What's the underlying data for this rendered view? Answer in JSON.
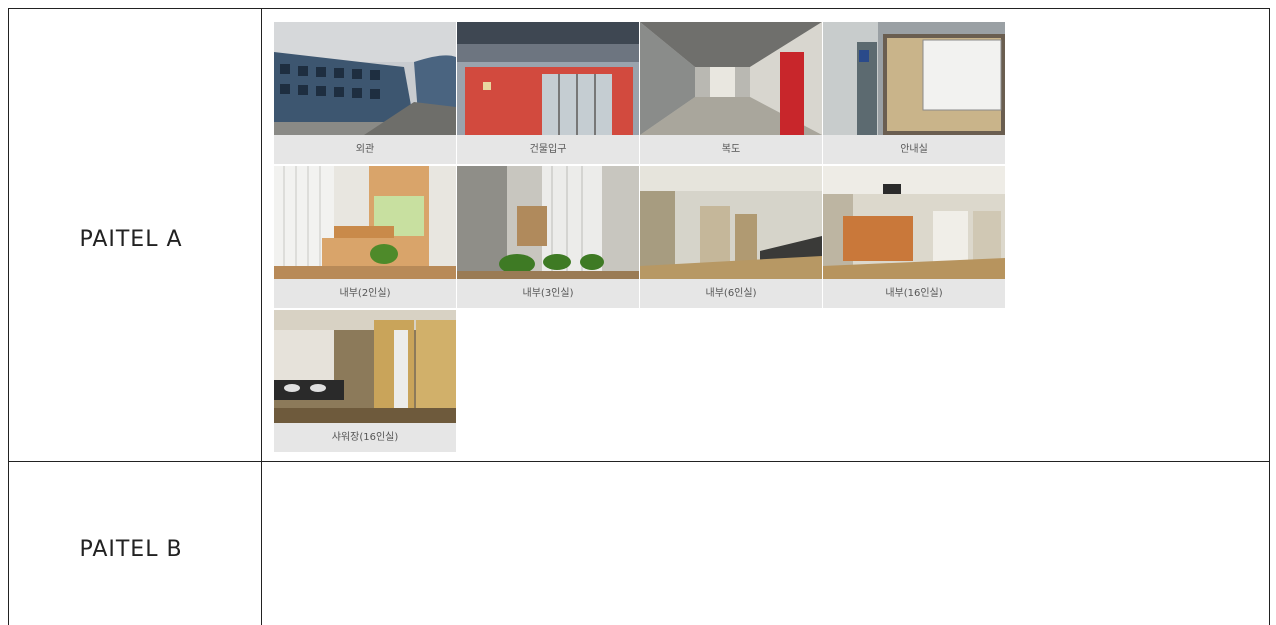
{
  "rows": [
    {
      "label": "PAITEL A",
      "photos": [
        {
          "caption": "외관",
          "icon": "building-exterior-photo"
        },
        {
          "caption": "건물입구",
          "icon": "building-entrance-photo"
        },
        {
          "caption": "복도",
          "icon": "corridor-photo"
        },
        {
          "caption": "안내실",
          "icon": "information-room-photo"
        },
        {
          "caption": "내부(2인실)",
          "icon": "double-room-photo"
        },
        {
          "caption": "내부(3인실)",
          "icon": "triple-room-photo"
        },
        {
          "caption": "내부(6인실)",
          "icon": "six-person-room-photo"
        },
        {
          "caption": "내부(16인실)",
          "icon": "sixteen-person-room-photo"
        },
        {
          "caption": "샤워장(16인실)",
          "icon": "shower-room-photo"
        }
      ]
    },
    {
      "label": "PAITEL B",
      "photos": []
    }
  ],
  "colors": {
    "border": "#222222",
    "caption_bg": "#e6e6e6",
    "caption_text": "#555555"
  }
}
